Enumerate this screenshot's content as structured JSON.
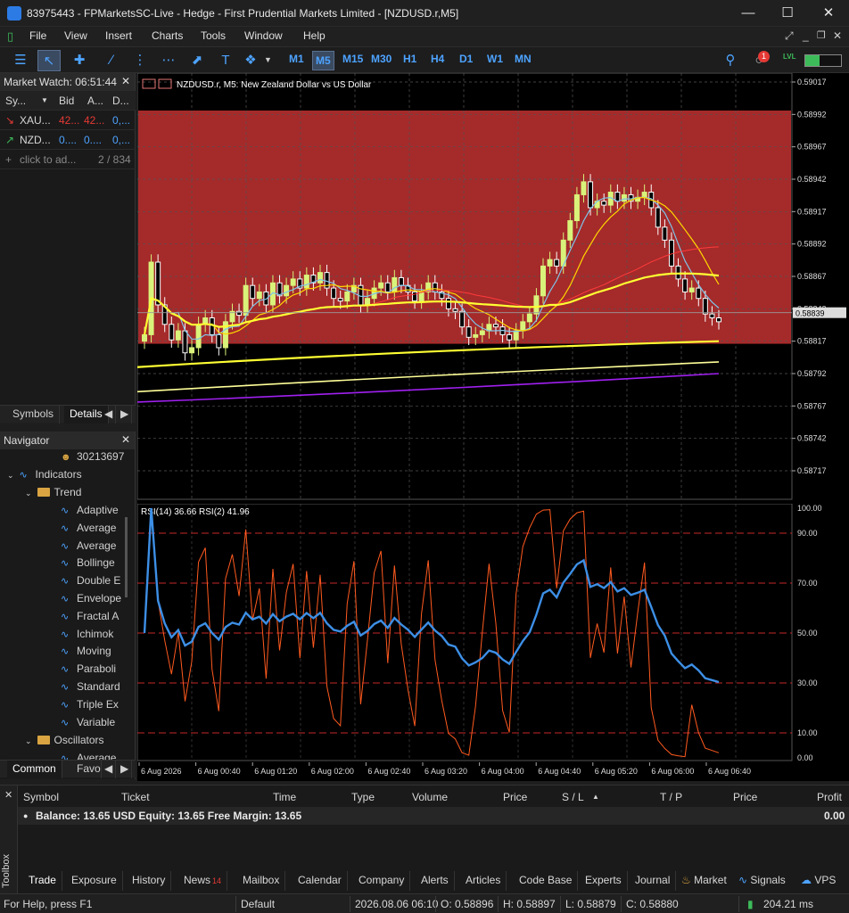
{
  "window": {
    "title": "83975443 - FPMarketsSC-Live - Hedge - First Prudential Markets Limited - [NZDUSD.r,M5]"
  },
  "menu": [
    "File",
    "View",
    "Insert",
    "Charts",
    "Tools",
    "Window",
    "Help"
  ],
  "timeframes": [
    "M1",
    "M5",
    "M15",
    "M30",
    "H1",
    "H4",
    "D1",
    "W1",
    "MN"
  ],
  "selected_timeframe": "M5",
  "notification_count": "1",
  "market_watch": {
    "title": "Market Watch: 06:51:44",
    "headers": [
      "Sy...",
      "Bid",
      "A...",
      "D..."
    ],
    "rows": [
      {
        "symbol": "XAU...",
        "bid": "42...",
        "ask": "42...",
        "daily": "0,..."
      },
      {
        "symbol": "NZD...",
        "bid": "0....",
        "ask": "0....",
        "daily": "0,..."
      }
    ],
    "add_label": "click to ad...",
    "count": "2 / 834",
    "tabs": [
      "Symbols",
      "Details"
    ]
  },
  "navigator": {
    "title": "Navigator",
    "account": "30213697",
    "indicators": "Indicators",
    "trend": "Trend",
    "trend_items": [
      "Adaptive",
      "Average",
      "Average",
      "Bollinge",
      "Double E",
      "Envelope",
      "Fractal A",
      "Ichimok",
      "Moving",
      "Paraboli",
      "Standard",
      "Triple Ex",
      "Variable"
    ],
    "oscillators": "Oscillators",
    "oscillator_first": "Average",
    "tabs": [
      "Common",
      "Favo"
    ]
  },
  "chart": {
    "label": "NZDUSD.r, M5:  New Zealand Dollar vs US Dollar",
    "current_price": "0.58839",
    "price_ticks": [
      "0.59017",
      "0.58992",
      "0.58967",
      "0.58942",
      "0.58917",
      "0.58892",
      "0.58867",
      "0.58842",
      "0.58817",
      "0.58792",
      "0.58767",
      "0.58742",
      "0.58717"
    ],
    "rsi_label": "RSI(14) 36.66 RSI(2) 41.96",
    "rsi_ticks": [
      "100.00",
      "90.00",
      "70.00",
      "50.00",
      "30.00",
      "10.00",
      "0.00"
    ],
    "time_ticks": [
      "6 Aug 2026",
      "6 Aug 00:40",
      "6 Aug 01:20",
      "6 Aug 02:00",
      "6 Aug 02:40",
      "6 Aug 03:20",
      "6 Aug 04:00",
      "6 Aug 04:40",
      "6 Aug 05:20",
      "6 Aug 06:00",
      "6 Aug 06:40"
    ],
    "colors": {
      "zone": "#a52a2a",
      "bull": "#d9f37a",
      "bear": "#ffffff",
      "ma_fast": "#7fc4e8",
      "ma_mid": "#ffd700",
      "ma_slow": "#ffff33",
      "ma_long": "#a020f0",
      "rsi14": "#3d8fe6",
      "rsi2": "#ff5a1f"
    }
  },
  "chart_data": {
    "type": "candlestick",
    "closes": [
      0.58822,
      0.58878,
      0.58845,
      0.5883,
      0.58818,
      0.58825,
      0.58808,
      0.58812,
      0.5883,
      0.58835,
      0.58822,
      0.58812,
      0.58832,
      0.5884,
      0.58837,
      0.5886,
      0.5885,
      0.58855,
      0.58845,
      0.58862,
      0.58852,
      0.5886,
      0.58865,
      0.58858,
      0.58868,
      0.58862,
      0.5887,
      0.58858,
      0.5885,
      0.58848,
      0.58855,
      0.5886,
      0.58845,
      0.5885,
      0.58858,
      0.58862,
      0.58855,
      0.58866,
      0.5886,
      0.58855,
      0.58848,
      0.58855,
      0.58862,
      0.58855,
      0.5885,
      0.58842,
      0.5884,
      0.58828,
      0.5882,
      0.58822,
      0.58825,
      0.5883,
      0.58828,
      0.58822,
      0.58818,
      0.58825,
      0.58832,
      0.58838,
      0.58852,
      0.58875,
      0.5888,
      0.58875,
      0.58895,
      0.5891,
      0.5893,
      0.5894,
      0.5892,
      0.58925,
      0.58922,
      0.58932,
      0.58925,
      0.5893,
      0.58925,
      0.58928,
      0.58932,
      0.5892,
      0.58905,
      0.58895,
      0.58875,
      0.58865,
      0.58855,
      0.58858,
      0.5885,
      0.58838,
      0.58835,
      0.58832
    ]
  },
  "toolbox": {
    "label": "Toolbox",
    "headers": [
      "Symbol",
      "Ticket",
      "Time",
      "Type",
      "Volume",
      "Price",
      "S / L",
      "T / P",
      "Price",
      "Profit"
    ],
    "balance": "Balance: 13.65 USD  Equity: 13.65  Free Margin: 13.65",
    "profit": "0.00",
    "tabs": [
      "Trade",
      "Exposure",
      "History",
      "News",
      "Mailbox",
      "Calendar",
      "Company",
      "Alerts",
      "Articles",
      "Code Base",
      "Experts",
      "Journal"
    ],
    "news_count": "14",
    "right_tabs": [
      "Market",
      "Signals",
      "VPS"
    ]
  },
  "status": {
    "help": "For Help, press F1",
    "profile": "Default",
    "datetime": "2026.08.06 06:10",
    "open": "O: 0.58896",
    "high": "H: 0.58897",
    "low": "L: 0.58879",
    "close": "C: 0.58880",
    "ping": "204.21 ms"
  }
}
